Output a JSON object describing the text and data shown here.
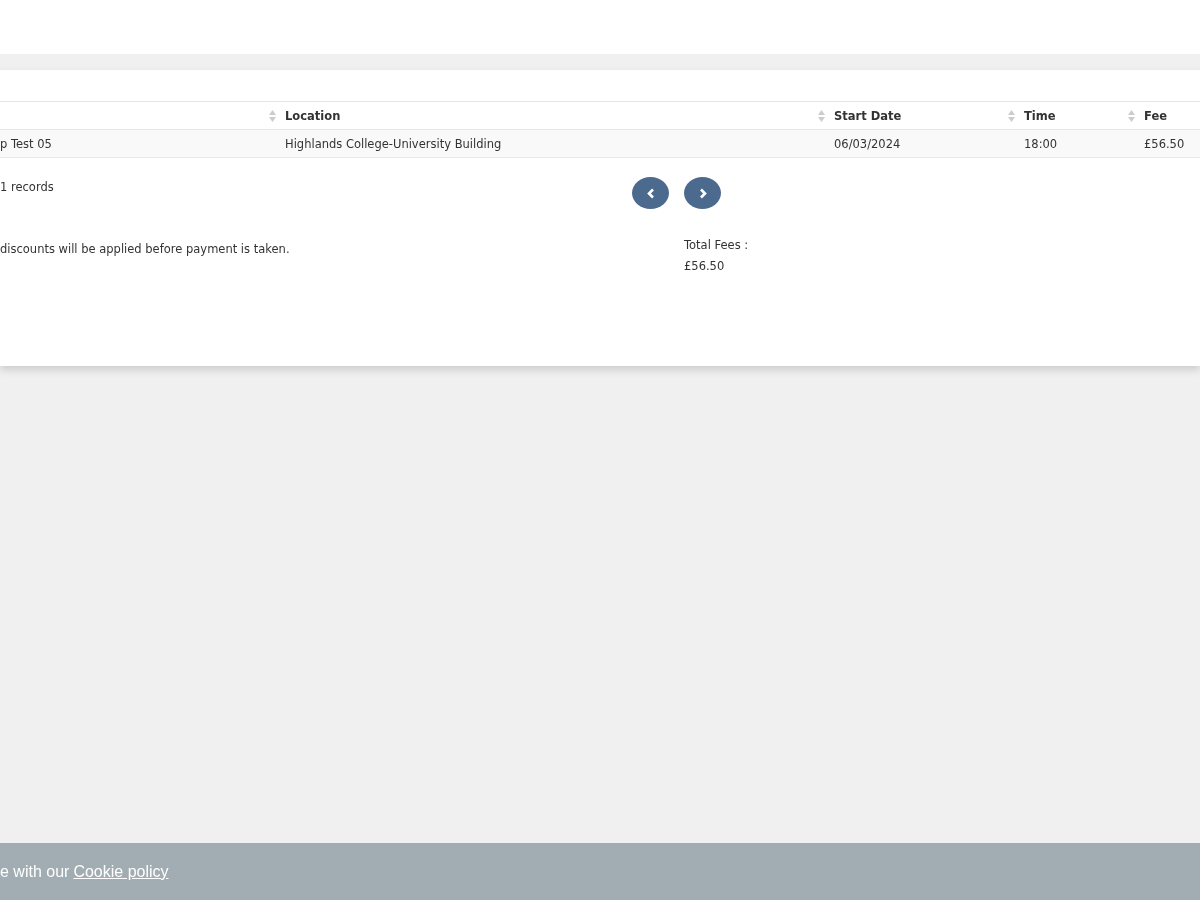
{
  "table": {
    "columns": [
      "",
      "Location",
      "Start Date",
      "Time",
      "Fee"
    ],
    "rows": [
      [
        "p Test 05",
        "Highlands College-University Building",
        "06/03/2024",
        "18:00",
        "£56.50"
      ]
    ]
  },
  "records": "1 records",
  "note": "discounts will be applied before payment is taken.",
  "total": {
    "label": "Total Fees :",
    "value": "£56.50"
  },
  "cookie": {
    "text": "e with our",
    "link": "Cookie policy"
  }
}
